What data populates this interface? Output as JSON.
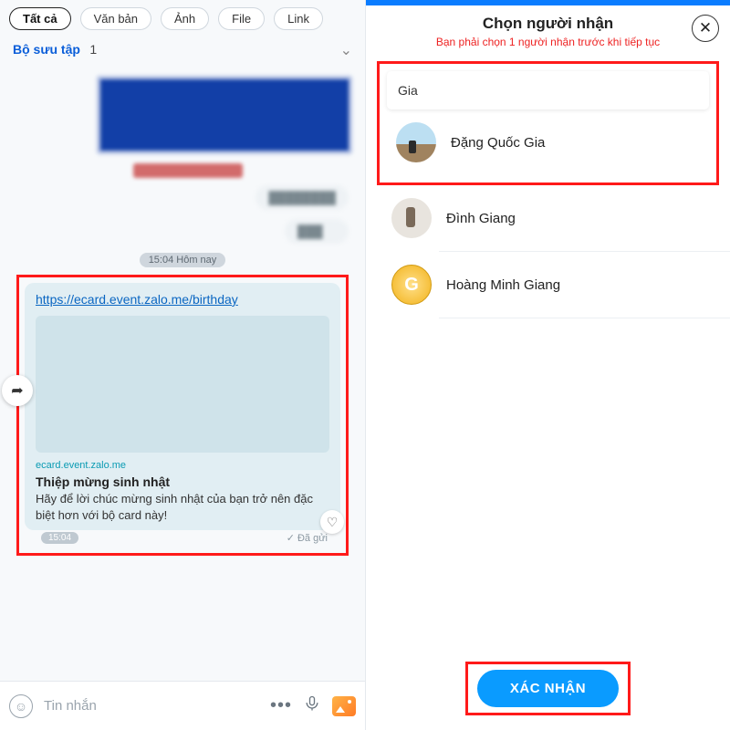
{
  "left": {
    "tabs": [
      "Tất cả",
      "Văn bản",
      "Ảnh",
      "File",
      "Link"
    ],
    "collection_label": "Bộ sưu tập",
    "collection_count": "1",
    "time_pill": "15:04 Hôm nay",
    "card": {
      "url": "https://ecard.event.zalo.me/birthday",
      "domain": "ecard.event.zalo.me",
      "title": "Thiệp mừng sinh nhật",
      "desc": "Hãy để lời chúc mừng sinh nhật của bạn trở nên đặc biệt hơn với bộ card này!"
    },
    "sent_time": "15:04",
    "sent_status": "Đã gửi",
    "composer_placeholder": "Tin nhắn"
  },
  "right": {
    "title": "Chọn người nhận",
    "subtitle": "Bạn phải chọn 1 người nhận trước khi tiếp tục",
    "search_value": "Gia",
    "contacts": [
      {
        "name": "Đặng Quốc Gia",
        "avatar": "sky"
      },
      {
        "name": "Đình Giang",
        "avatar": "plain"
      },
      {
        "name": "Hoàng Minh Giang",
        "avatar": "letter",
        "letter": "G"
      }
    ],
    "confirm_label": "XÁC NHẬN"
  }
}
